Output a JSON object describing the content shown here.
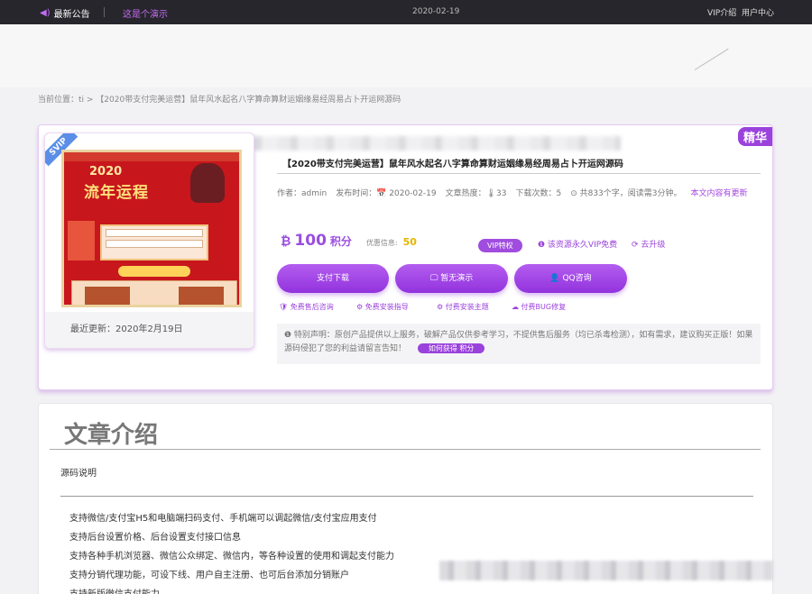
{
  "topbar": {
    "notice_label": "最新公告",
    "demo_link": "这是个演示",
    "date": "2020-02-19",
    "vip_intro": "VIP介绍",
    "user_center": "用户中心"
  },
  "breadcrumb": "当前位置：ti > 【2020带支付完美运营】鼠年风水起名八字算命算财运姻缘易经周易占卜开运网源码",
  "product": {
    "badge": "精华",
    "svip": "SVIP",
    "thumb_update": "最近更新：2020年2月19日",
    "poster": {
      "year": "2020",
      "title": "流年运程"
    },
    "title": "【2020带支付完美运营】鼠年风水起名八字算命算财运姻缘易经周易占卜开运网源码",
    "meta": {
      "author": "作者：admin",
      "publish": "发布时间：📅 2020-02-19",
      "heat": "文章热度：🌡33",
      "downloads": "下载次数：5",
      "words": "⊙ 共833个字，阅读需3分钟。",
      "updated": "本文内容有更新"
    },
    "price": {
      "coin_icon": "coin-icon",
      "value": "100",
      "unit": "积分",
      "discount_label": "优惠信息:",
      "discount_value": "50"
    },
    "vip_badge": "VIP特权",
    "vip_free": "❶ 该资源永久VIP免费",
    "upgrade": "⟳ 去升级",
    "buttons": {
      "pay": "支付下载",
      "demo": "🖵 暂无演示",
      "qq": "👤 QQ咨询"
    },
    "services": {
      "after_sale": "🛡 免费售后咨询",
      "install_guide": "⚙ 免费安装指导",
      "paid_theme": "⚙ 付费安装主题",
      "bug_fix": "☁ 付费BUG修复"
    },
    "statement": "❶ 特别声明：原创产品提供以上服务，破解产品仅供参考学习，不提供售后服务（均已杀毒检测），如有需求，建议购买正版！如果源码侵犯了您的利益请留言告知！",
    "howto": "如何获得 积分"
  },
  "intro": {
    "heading": "文章介绍",
    "subheading": "源码说明",
    "items": [
      "支持微信/支付宝H5和电脑端扫码支付、手机端可以调起微信/支付宝应用支付",
      "支持后台设置价格、后台设置支付接口信息",
      "支持各种手机浏览器、微信公众绑定、微信内，等各种设置的使用和调起支付能力",
      "支持分销代理功能，可设下线、用户自主注册、也可后台添加分销账户",
      "支持新版微信支付能力"
    ]
  },
  "colors": {
    "accent": "#9a42dc",
    "topbar": "#26262c",
    "discount": "#e6b400"
  }
}
